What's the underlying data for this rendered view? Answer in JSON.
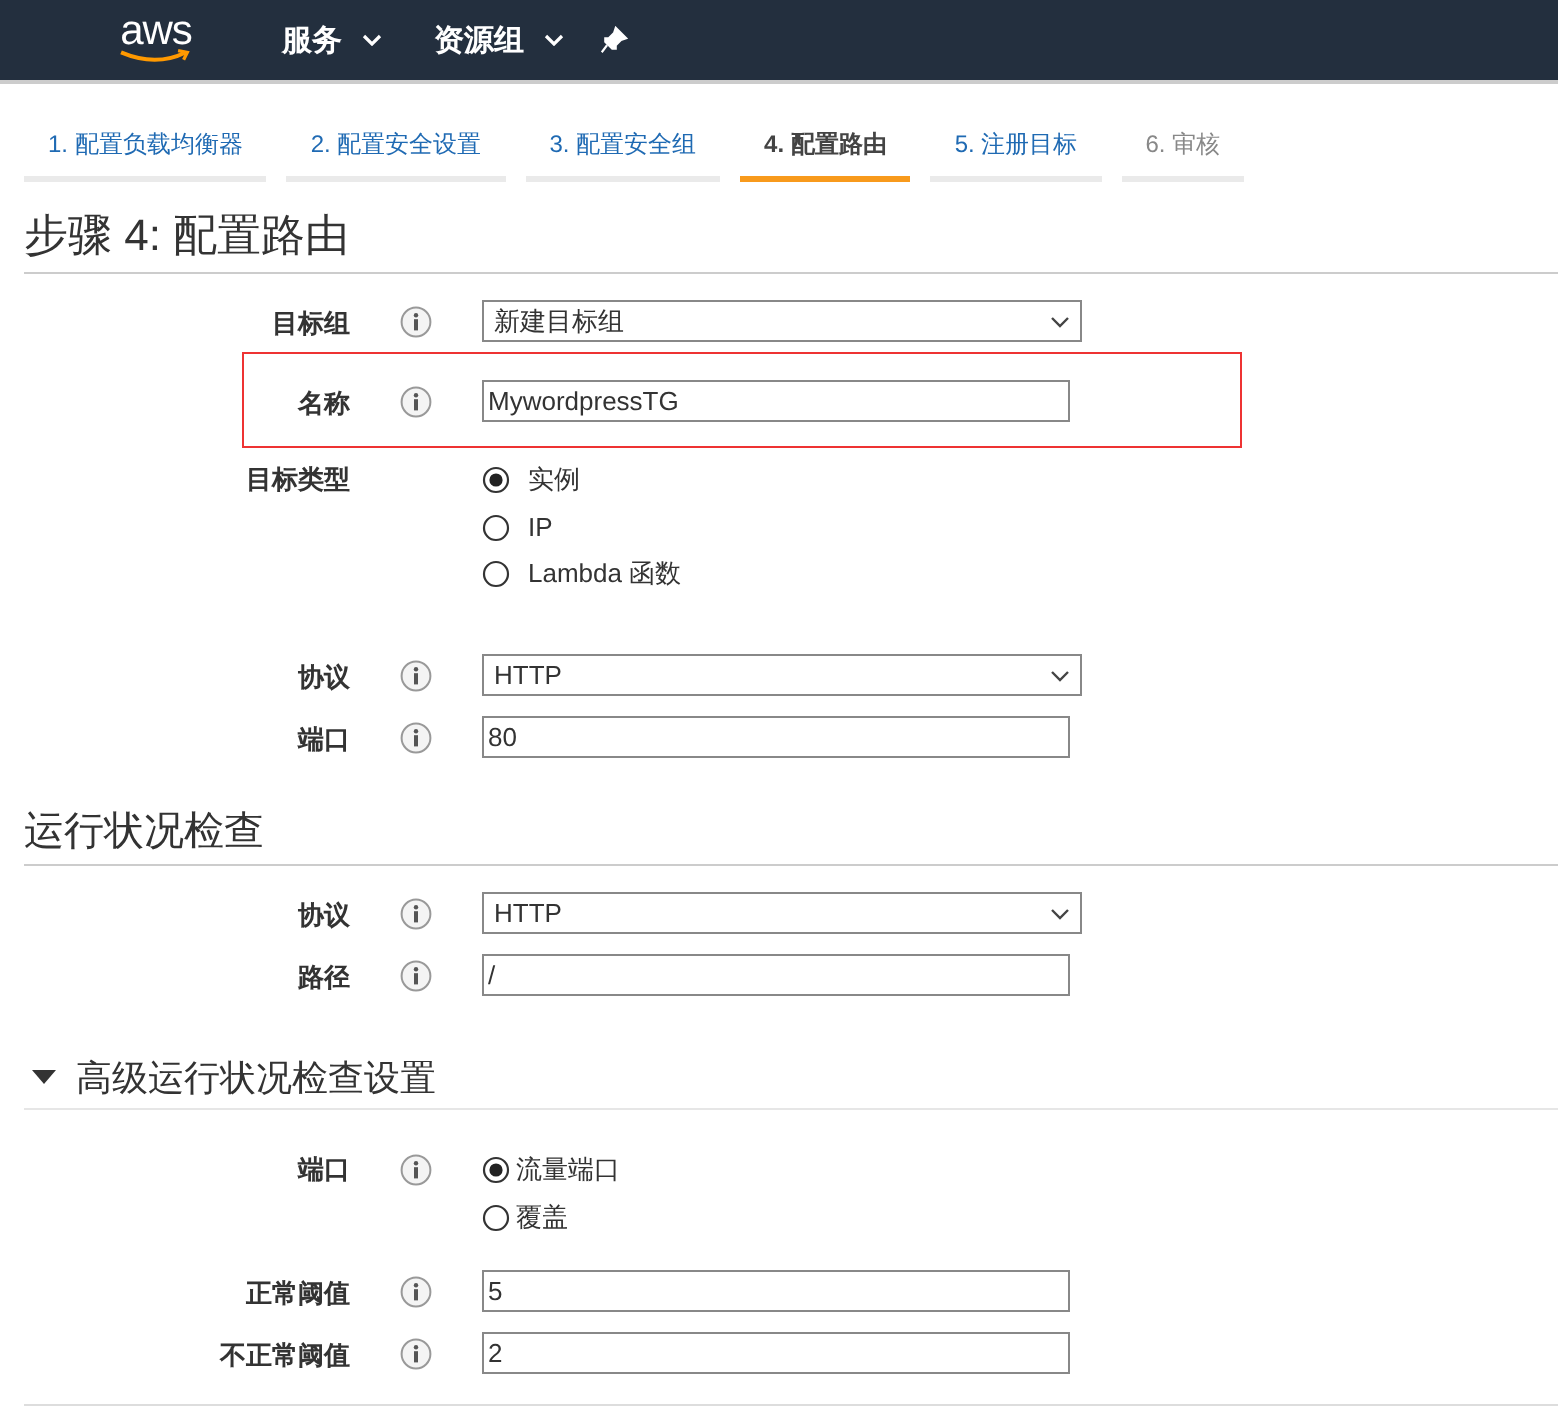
{
  "nav": {
    "logo": "aws",
    "items": [
      {
        "label": "服务",
        "dropdown": true
      },
      {
        "label": "资源组",
        "dropdown": true
      }
    ]
  },
  "steps": [
    {
      "label": "1. 配置负载均衡器",
      "selected": false,
      "disabled": false
    },
    {
      "label": "2. 配置安全设置",
      "selected": false,
      "disabled": false
    },
    {
      "label": "3. 配置安全组",
      "selected": false,
      "disabled": false
    },
    {
      "label": "4. 配置路由",
      "selected": true,
      "disabled": false
    },
    {
      "label": "5. 注册目标",
      "selected": false,
      "disabled": false
    },
    {
      "label": "6. 审核",
      "selected": false,
      "disabled": true
    }
  ],
  "sections": [
    {
      "title": "步骤 4: 配置路由",
      "kind": "page",
      "fields": [
        {
          "label": "目标组",
          "kind": "select",
          "value": "新建目标组",
          "highlighted": false
        },
        {
          "label": "名称",
          "kind": "text",
          "value": "MywordpressTG",
          "highlighted": true
        },
        {
          "label": "目标类型",
          "kind": "radio",
          "info": false,
          "options": [
            {
              "label": "实例",
              "selected": true
            },
            {
              "label": "IP",
              "selected": false
            },
            {
              "label": "Lambda 函数",
              "selected": false
            }
          ],
          "highlighted": false
        },
        {
          "label": "协议",
          "kind": "select",
          "value": "HTTP",
          "highlighted": false
        },
        {
          "label": "端口",
          "kind": "text",
          "value": "80",
          "highlighted": false
        }
      ]
    },
    {
      "title": "运行状况检查",
      "kind": "section",
      "fields": [
        {
          "label": "协议",
          "kind": "select",
          "value": "HTTP",
          "highlighted": false
        },
        {
          "label": "路径",
          "kind": "text",
          "value": "/",
          "highlighted": false
        }
      ]
    },
    {
      "title": "高级运行状况检查设置",
      "kind": "collapsible",
      "expanded": true,
      "fields": [
        {
          "label": "端口",
          "kind": "radio",
          "options": [
            {
              "label": "流量端口",
              "selected": true
            },
            {
              "label": "覆盖",
              "selected": false
            }
          ],
          "highlighted": false
        },
        {
          "label": "正常阈值",
          "kind": "text",
          "value": "5",
          "highlighted": false
        },
        {
          "label": "不正常阈值",
          "kind": "text",
          "value": "2",
          "highlighted": false
        }
      ]
    }
  ]
}
